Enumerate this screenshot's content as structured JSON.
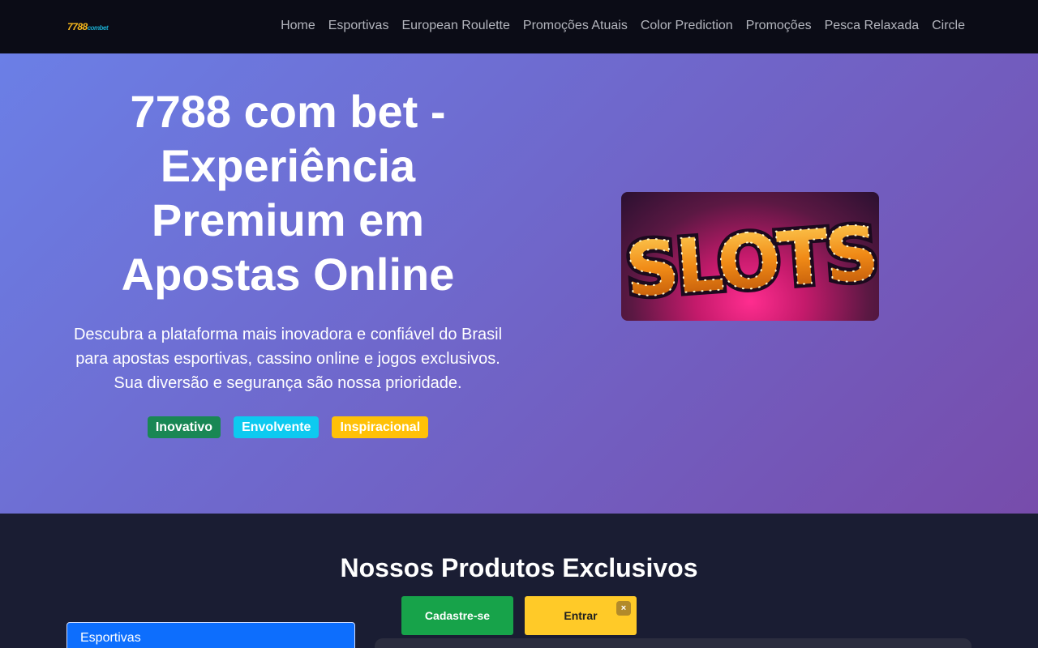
{
  "nav": {
    "logo_main": "7788",
    "logo_sub": "combet",
    "links": [
      "Home",
      "Esportivas",
      "European Roulette",
      "Promoções Atuais",
      "Color Prediction",
      "Promoções",
      "Pesca Relaxada",
      "Circle"
    ]
  },
  "hero": {
    "title": "7788 com bet - Experiência Premium em Apostas Online",
    "description": "Descubra a plataforma mais inovadora e confiável do Brasil para apostas esportivas, cassino online e jogos exclusivos. Sua diversão e segurança são nossa prioridade.",
    "badges": [
      "Inovativo",
      "Envolvente",
      "Inspiracional"
    ],
    "image_text": "SLOTS"
  },
  "products": {
    "title": "Nossos Produtos Exclusivos",
    "register_label": "Cadastre-se",
    "login_label": "Entrar",
    "close_label": "×",
    "tab_label": "Esportivas"
  }
}
